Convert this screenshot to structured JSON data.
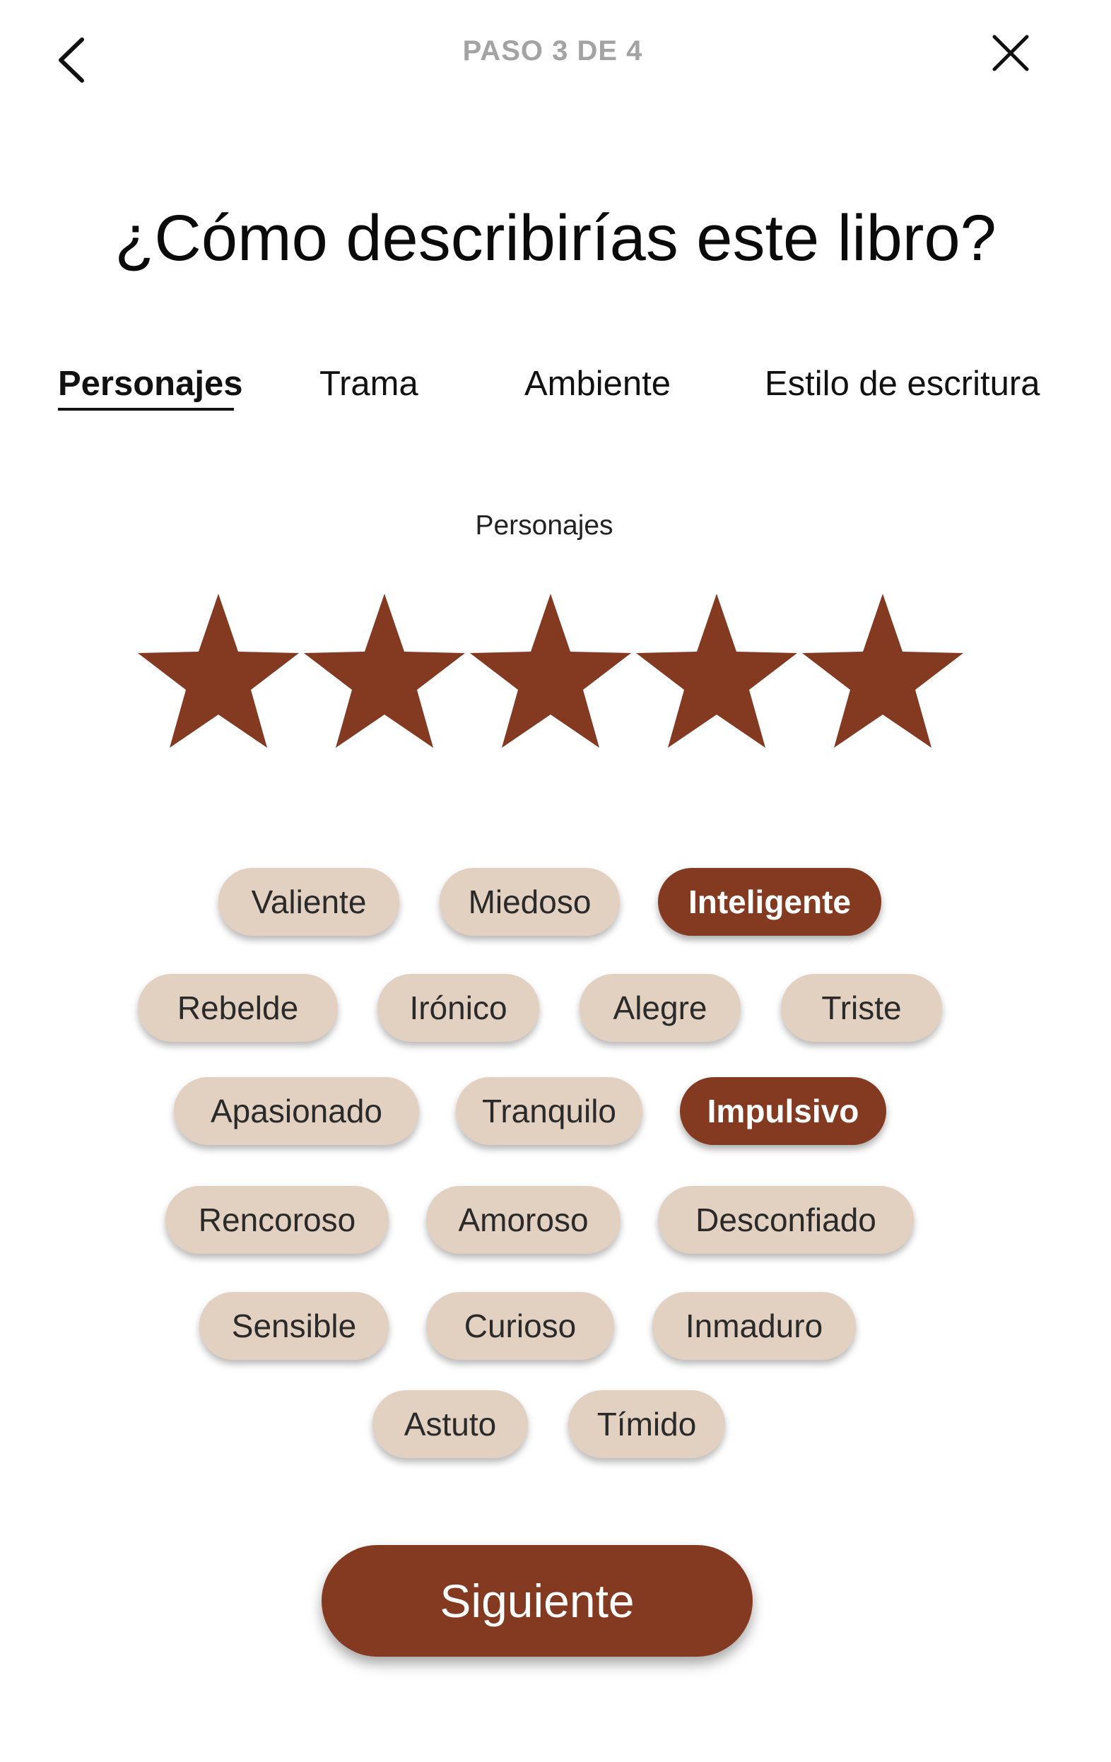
{
  "header": {
    "step_text": "PASO 3  DE 4",
    "back_icon": "chevron-left-icon",
    "close_icon": "close-icon"
  },
  "title": "¿Cómo describirías este libro?",
  "tabs": [
    {
      "label": "Personajes",
      "active": true
    },
    {
      "label": "Trama",
      "active": false
    },
    {
      "label": "Ambiente",
      "active": false
    },
    {
      "label": "Estilo de escritura",
      "active": false
    }
  ],
  "section_label": "Personajes",
  "rating": {
    "value": 5,
    "max": 5,
    "star_color": "#843921"
  },
  "chips": [
    {
      "label": "Valiente",
      "selected": false
    },
    {
      "label": "Miedoso",
      "selected": false
    },
    {
      "label": "Inteligente",
      "selected": true
    },
    {
      "label": "Rebelde",
      "selected": false
    },
    {
      "label": "Irónico",
      "selected": false
    },
    {
      "label": "Alegre",
      "selected": false
    },
    {
      "label": "Triste",
      "selected": false
    },
    {
      "label": "Apasionado",
      "selected": false
    },
    {
      "label": "Tranquilo",
      "selected": false
    },
    {
      "label": "Impulsivo",
      "selected": true
    },
    {
      "label": "Rencoroso",
      "selected": false
    },
    {
      "label": "Amoroso",
      "selected": false
    },
    {
      "label": "Desconfiado",
      "selected": false
    },
    {
      "label": "Sensible",
      "selected": false
    },
    {
      "label": "Curioso",
      "selected": false
    },
    {
      "label": "Inmaduro",
      "selected": false
    },
    {
      "label": "Astuto",
      "selected": false
    },
    {
      "label": "Tímido",
      "selected": false
    }
  ],
  "colors": {
    "accent": "#843921",
    "chip_background": "#e2d0c0",
    "step_text": "#a3a3a3"
  },
  "next_button": {
    "label": "Siguiente"
  }
}
